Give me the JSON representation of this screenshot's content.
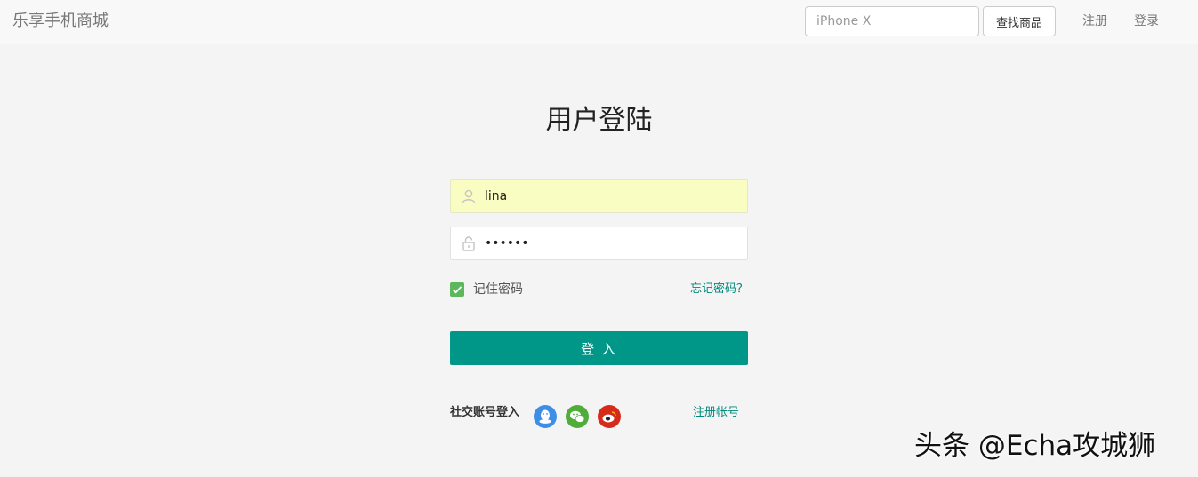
{
  "navbar": {
    "brand": "乐享手机商城",
    "search": {
      "value": "",
      "placeholder": "iPhone X",
      "button_label": "查找商品"
    },
    "links": {
      "register": "注册",
      "login": "登录"
    }
  },
  "login": {
    "title": "用户登陆",
    "username": {
      "value": "lina",
      "icon": "user-icon"
    },
    "password": {
      "value": "••••••",
      "icon": "lock-icon"
    },
    "remember": {
      "label": "记住密码",
      "checked": true
    },
    "forgot_label": "忘记密码？",
    "submit_label": "登 入",
    "social": {
      "label": "社交账号登入",
      "providers": [
        "qq-icon",
        "wechat-icon",
        "weibo-icon"
      ]
    },
    "register_label": "注册帐号"
  },
  "watermark": "头条 @Echa攻城狮",
  "colors": {
    "accent": "#009688",
    "link": "#00897b",
    "autofill": "#fafdc1",
    "checkbox": "#5cb85c",
    "qq": "#3d8ee6",
    "wechat": "#50ad39",
    "weibo": "#d62a1a"
  }
}
